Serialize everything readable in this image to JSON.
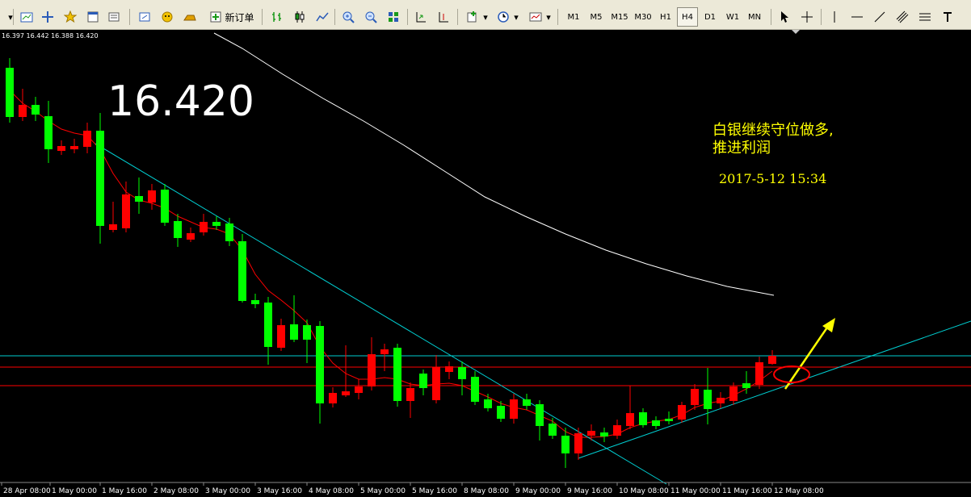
{
  "toolbar": {
    "new_order_label": "新订单",
    "timeframes": [
      "M1",
      "M5",
      "M15",
      "M30",
      "H1",
      "H4",
      "D1",
      "W1",
      "MN"
    ],
    "active_timeframe": "H4"
  },
  "chart": {
    "symbol_ohlc": "16.397 16.442 16.388 16.420",
    "current_price": "16.420",
    "annotation_line1": "白银继续守位做多,",
    "annotation_line2": "推进利润",
    "annotation_datetime": "2017-5-12  15:34",
    "colors": {
      "bull": "#00ff00",
      "bear": "#ff0000",
      "trend": "#00ced1",
      "ma": "#ffffff",
      "arrow": "#ffff00"
    }
  },
  "chart_data": {
    "type": "candlestick",
    "x_tick_labels": [
      "28 Apr 08:00",
      "1 May 00:00",
      "1 May 16:00",
      "2 May 08:00",
      "3 May 00:00",
      "3 May 16:00",
      "4 May 08:00",
      "5 May 00:00",
      "5 May 16:00",
      "8 May 08:00",
      "9 May 00:00",
      "9 May 16:00",
      "10 May 08:00",
      "11 May 00:00",
      "11 May 16:00",
      "12 May 08:00"
    ]
  }
}
